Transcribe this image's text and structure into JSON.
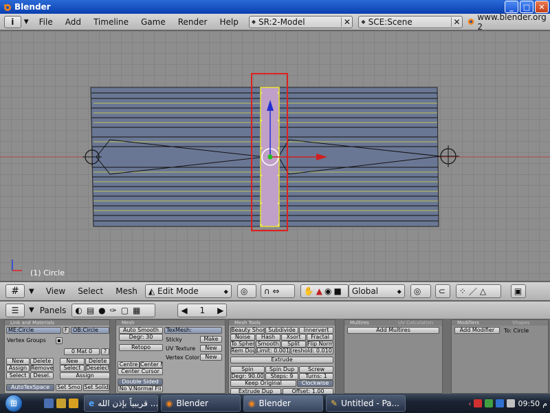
{
  "window": {
    "title": "Blender",
    "controls": [
      "_",
      "□",
      "✕"
    ]
  },
  "top_header": {
    "menus": [
      "File",
      "Add",
      "Timeline",
      "Game",
      "Render",
      "Help"
    ],
    "screen_field": "SR:2-Model",
    "scene_field": "SCE:Scene",
    "website": "www.blender.org 2"
  },
  "viewport": {
    "object_label": "(1) Circle",
    "colors": {
      "background": "#8e8e8e",
      "mesh_fill": "#6a7794",
      "selected": "#c0a0c8",
      "selection_box": "#e02020",
      "edge": "#d6d64a"
    }
  },
  "viewport_header": {
    "menus": [
      "View",
      "Select",
      "Mesh"
    ],
    "mode": "Edit Mode",
    "orientation": "Global"
  },
  "buttons_header": {
    "panels_label": "Panels",
    "frame": "1"
  },
  "panels": {
    "link_materials": {
      "title": "Link and Materials",
      "me_field": "ME:Circle",
      "f_label": "F",
      "ob_field": "OB:Circle",
      "vertex_groups": "Vertex Groups",
      "mat_field": "0 Mat 0",
      "q": "?",
      "buttons_left": [
        "New",
        "Delete",
        "Assign",
        "Remove",
        "Select",
        "Desel."
      ],
      "buttons_right": [
        "New",
        "Delete",
        "Select",
        "Deselect",
        "Assign"
      ],
      "autotex": "AutoTexSpace",
      "set_smo": "Set Smo",
      "set_solid": "Set Solid"
    },
    "mesh": {
      "title": "Mesh",
      "auto_smooth": "Auto Smooth",
      "degr": "Degr: 30",
      "retopo": "Retopo",
      "centre": "Centre",
      "centre_new": "Center Ne",
      "center_cursor": "Center Cursor",
      "double_sided": "Double Sided",
      "no_vnormal": "No V.Normal Fli",
      "texmesh": "TexMesh:",
      "sticky": "Sticky",
      "make": "Make",
      "uv_texture": "UV Texture",
      "vertex_color": "Vertex Color",
      "new1": "New",
      "new2": "New"
    },
    "mesh_tools": {
      "title": "Mesh Tools",
      "beauty_short": "Beauty Short",
      "subdivide": "Subdivide",
      "innervert": "Innervert",
      "noise": "Noise",
      "hash": "Hash",
      "xsort": "Xsort",
      "fractal": "Fractal",
      "to_sphere": "To Spher",
      "smooth": "Smooth",
      "split": "Split",
      "flip_norm": "Flip Norm",
      "rem_dou": "Rem Dou",
      "limit": "Limit: 0.001",
      "threshold": "reshold: 0.010",
      "extrude": "Extrude",
      "spin": "Spin",
      "spin_dup": "Spin Dup",
      "screw": "Screw",
      "degr": "Degr: 90.00",
      "steps": "Steps: 9",
      "turns": "Turns: 1",
      "keep_original": "Keep Original",
      "clockwise": "Clockwise",
      "extrude_dup": "Extrude Dup",
      "offset": "Offset: 1.00"
    },
    "multires": {
      "title": "Multires",
      "tab2": "UV Calculation",
      "add_multires": "Add Multires"
    },
    "modifiers": {
      "title": "Modifiers",
      "tab2": "Shapes",
      "add_modifier": "Add Modifier",
      "to": "To: Circle"
    }
  },
  "taskbar": {
    "tasks": [
      "قرببياً بإذن الله ...",
      "Blender",
      "Blender",
      "Untitled - Pa..."
    ],
    "time": "09:50",
    "ampm": "م"
  }
}
